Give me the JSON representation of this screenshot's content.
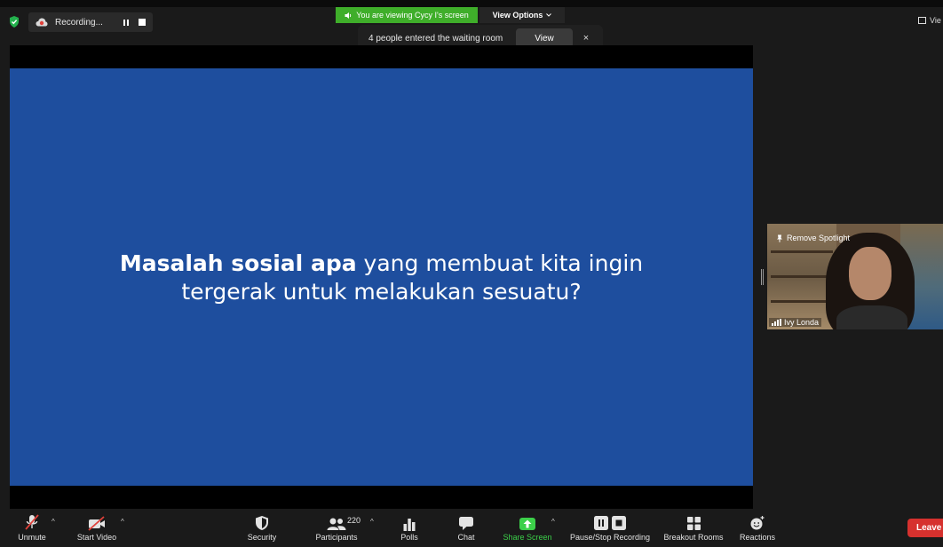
{
  "recording": {
    "label": "Recording..."
  },
  "banner": {
    "viewing_text": "You are viewing Cycy I's screen",
    "view_options_label": "View Options"
  },
  "notification": {
    "text": "4 people entered the waiting room",
    "view_button": "View",
    "close_glyph": "×"
  },
  "top_right": {
    "label": "Vie"
  },
  "slide": {
    "bold_text": "Masalah sosial apa",
    "line1_rest": "yang membuat kita ingin",
    "line2": "tergerak untuk melakukan sesuatu?",
    "background": "#1e4e9e"
  },
  "video": {
    "remove_spotlight_label": "Remove Spotlight",
    "participant_name": "Ivy Londa"
  },
  "toolbar": {
    "unmute_label": "Unmute",
    "start_video_label": "Start Video",
    "security_label": "Security",
    "participants_label": "Participants",
    "participants_count": "220",
    "polls_label": "Polls",
    "chat_label": "Chat",
    "share_screen_label": "Share Screen",
    "recording_label": "Pause/Stop Recording",
    "breakout_label": "Breakout Rooms",
    "reactions_label": "Reactions",
    "leave_label": "Leave"
  },
  "colors": {
    "accent_green": "#3fae2a",
    "share_green": "#3cd04a",
    "leave_red": "#d6312e",
    "muted_red": "#e0403a"
  },
  "icons": {
    "shield": "shield-icon",
    "cloud": "cloud-record-icon",
    "microphone": "microphone-muted-icon",
    "camera": "camera-off-icon",
    "participants": "participants-icon",
    "polls": "bar-chart-icon",
    "chat": "chat-bubble-icon",
    "share": "share-screen-arrow-icon",
    "breakout": "grid-icon",
    "reactions": "smiley-icon"
  }
}
